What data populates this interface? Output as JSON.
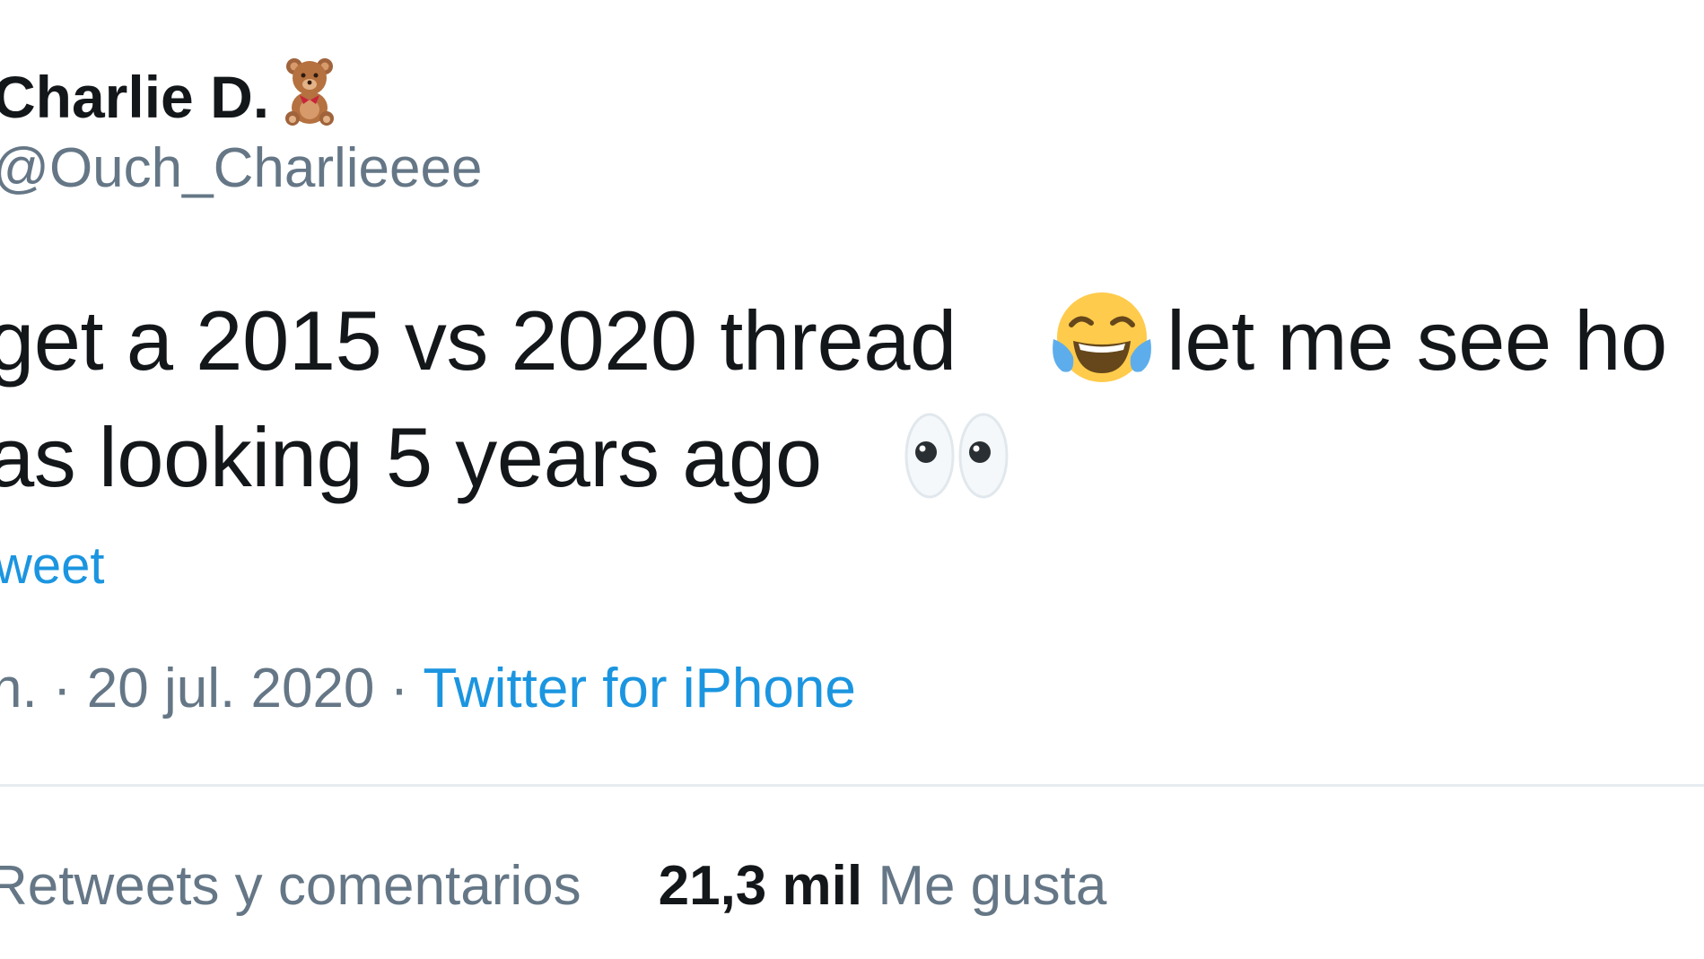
{
  "tweet": {
    "display_name": "Charlie D.",
    "display_name_emoji": "teddy-bear-icon",
    "handle": "@Ouch_Charlieeee",
    "text_line_1_a": "get a 2015 vs 2020 thread",
    "text_line_1_b": "let me see ho",
    "text_line_2": "as looking 5 years ago",
    "emoji_1": "tears-of-joy-icon",
    "emoji_2": "eyes-icon",
    "show_thread_label": "weet",
    "meta_prefix": "n. · 20 jul. 2020 ·",
    "source": "Twitter for iPhone",
    "retweets_label": "Retweets y comentarios",
    "likes_count": "21,3 mil",
    "likes_label": "Me gusta"
  },
  "colors": {
    "text": "#14171a",
    "secondary": "#657786",
    "link": "#1b95e0",
    "divider": "#e6ecf0"
  }
}
